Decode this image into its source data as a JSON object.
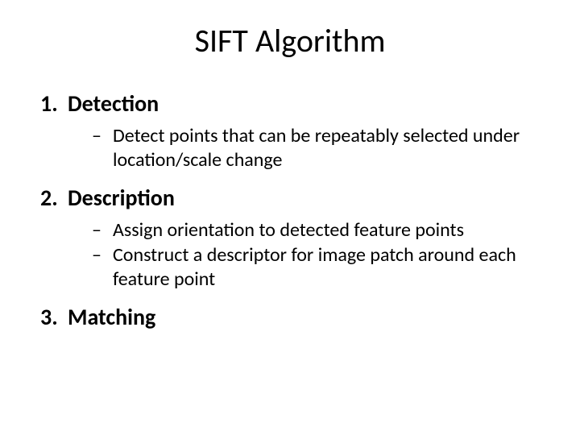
{
  "slide": {
    "title": "SIFT Algorithm",
    "items": [
      {
        "label": "Detection",
        "sub": [
          "Detect points that can be repeatably selected under location/scale change"
        ]
      },
      {
        "label": "Description",
        "sub": [
          "Assign orientation to detected feature points",
          "Construct a descriptor for image patch around each feature point"
        ]
      },
      {
        "label": "Matching",
        "sub": []
      }
    ]
  }
}
